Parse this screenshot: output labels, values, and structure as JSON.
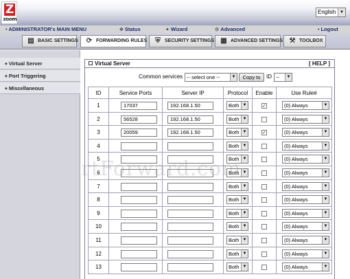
{
  "brand": {
    "logo_letter": "Z",
    "logo_word": "zoom"
  },
  "language": {
    "selected": "English"
  },
  "menu_bar": {
    "title": "ADMINISTRATOR's MAIN MENU",
    "status": "Status",
    "wizard": "Wizard",
    "advanced": "Advanced",
    "logout": "Logout"
  },
  "tabs": {
    "basic": "BASIC SETTINGS",
    "forwarding": "FORWARDING RULES",
    "security": "SECURITY SETTINGS",
    "advanced": "ADVANCED SETTINGS",
    "toolbox": "TOOLBOX"
  },
  "sidebar": {
    "items": [
      {
        "label": "Virtual Server"
      },
      {
        "label": "Port Triggering"
      },
      {
        "label": "Miscellaneous"
      }
    ]
  },
  "panel": {
    "title": "Virtual Server",
    "help": "[ HELP ]",
    "common_services_label": "Common services",
    "common_services_value": "-- select one --",
    "copy_button": "Copy to",
    "id_label": "ID",
    "id_value": "--"
  },
  "table": {
    "headers": {
      "id": "ID",
      "service_ports": "Service Ports",
      "server_ip": "Server IP",
      "protocol": "Protocol",
      "enable": "Enable",
      "use_rule": "Use Rule#"
    },
    "rows": [
      {
        "id": "1",
        "port": "17037",
        "ip": "192.168.1.50",
        "protocol": "Both",
        "enabled": true,
        "rule": "(0) Always"
      },
      {
        "id": "2",
        "port": "56528",
        "ip": "192.168.1.50",
        "protocol": "Both",
        "enabled": false,
        "rule": "(0) Always"
      },
      {
        "id": "3",
        "port": "20059",
        "ip": "192.168.1.50",
        "protocol": "Both",
        "enabled": true,
        "rule": "(0) Always"
      },
      {
        "id": "4",
        "port": "",
        "ip": "",
        "protocol": "Both",
        "enabled": false,
        "rule": "(0) Always"
      },
      {
        "id": "5",
        "port": "",
        "ip": "",
        "protocol": "Both",
        "enabled": false,
        "rule": "(0) Always"
      },
      {
        "id": "6",
        "port": "",
        "ip": "",
        "protocol": "Both",
        "enabled": false,
        "rule": "(0) Always"
      },
      {
        "id": "7",
        "port": "",
        "ip": "",
        "protocol": "Both",
        "enabled": false,
        "rule": "(0) Always"
      },
      {
        "id": "8",
        "port": "",
        "ip": "",
        "protocol": "Both",
        "enabled": false,
        "rule": "(0) Always"
      },
      {
        "id": "9",
        "port": "",
        "ip": "",
        "protocol": "Both",
        "enabled": false,
        "rule": "(0) Always"
      },
      {
        "id": "10",
        "port": "",
        "ip": "",
        "protocol": "Both",
        "enabled": false,
        "rule": "(0) Always"
      },
      {
        "id": "11",
        "port": "",
        "ip": "",
        "protocol": "Both",
        "enabled": false,
        "rule": "(0) Always"
      },
      {
        "id": "12",
        "port": "",
        "ip": "",
        "protocol": "Both",
        "enabled": false,
        "rule": "(0) Always"
      },
      {
        "id": "13",
        "port": "",
        "ip": "",
        "protocol": "Both",
        "enabled": false,
        "rule": "(0) Always"
      }
    ]
  },
  "watermark": "rtForward.com",
  "colors": {
    "brand_red": "#d22020",
    "menu_text": "#1a2a6e",
    "sidebar_bg": "#d4d5dd"
  }
}
